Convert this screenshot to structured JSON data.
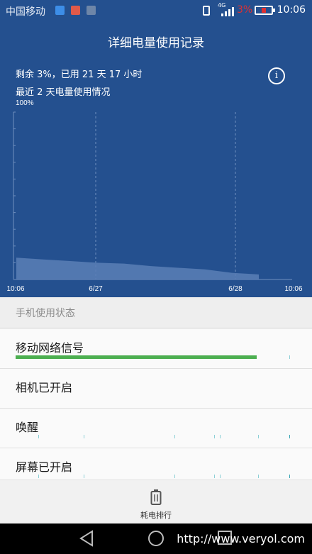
{
  "status_bar": {
    "carrier": "中国移动",
    "network": "4G",
    "battery_percent": "3%",
    "time": "10:06"
  },
  "header": {
    "title": "详细电量使用记录",
    "summary": "剩余 3%，已用 21 天 17 小时",
    "subtitle": "最近 2 天电量使用情况",
    "info_icon": "i"
  },
  "chart_data": {
    "type": "area",
    "ylabel": "100%",
    "ylim": [
      0,
      100
    ],
    "x_tick_labels": [
      "10:06",
      "6/27",
      "6/28",
      "10:06"
    ],
    "values": [
      13,
      12,
      11,
      10,
      9.5,
      8,
      7,
      6,
      4,
      3
    ],
    "grid": "vertical dashed at 6/27 and 6/28"
  },
  "usage": {
    "section_title": "手机使用状态",
    "rows": [
      {
        "label": "移动网络信号",
        "fill": 0.85
      },
      {
        "label": "相机已开启"
      },
      {
        "label": "唤醒"
      },
      {
        "label": "屏幕已开启"
      }
    ]
  },
  "bottom": {
    "label": "耗电排行"
  },
  "watermark": "http://www.veryol.com",
  "colors": {
    "header_bg": "#24508f",
    "signal_bar": "#4caf50",
    "battery_low": "#e03030"
  }
}
